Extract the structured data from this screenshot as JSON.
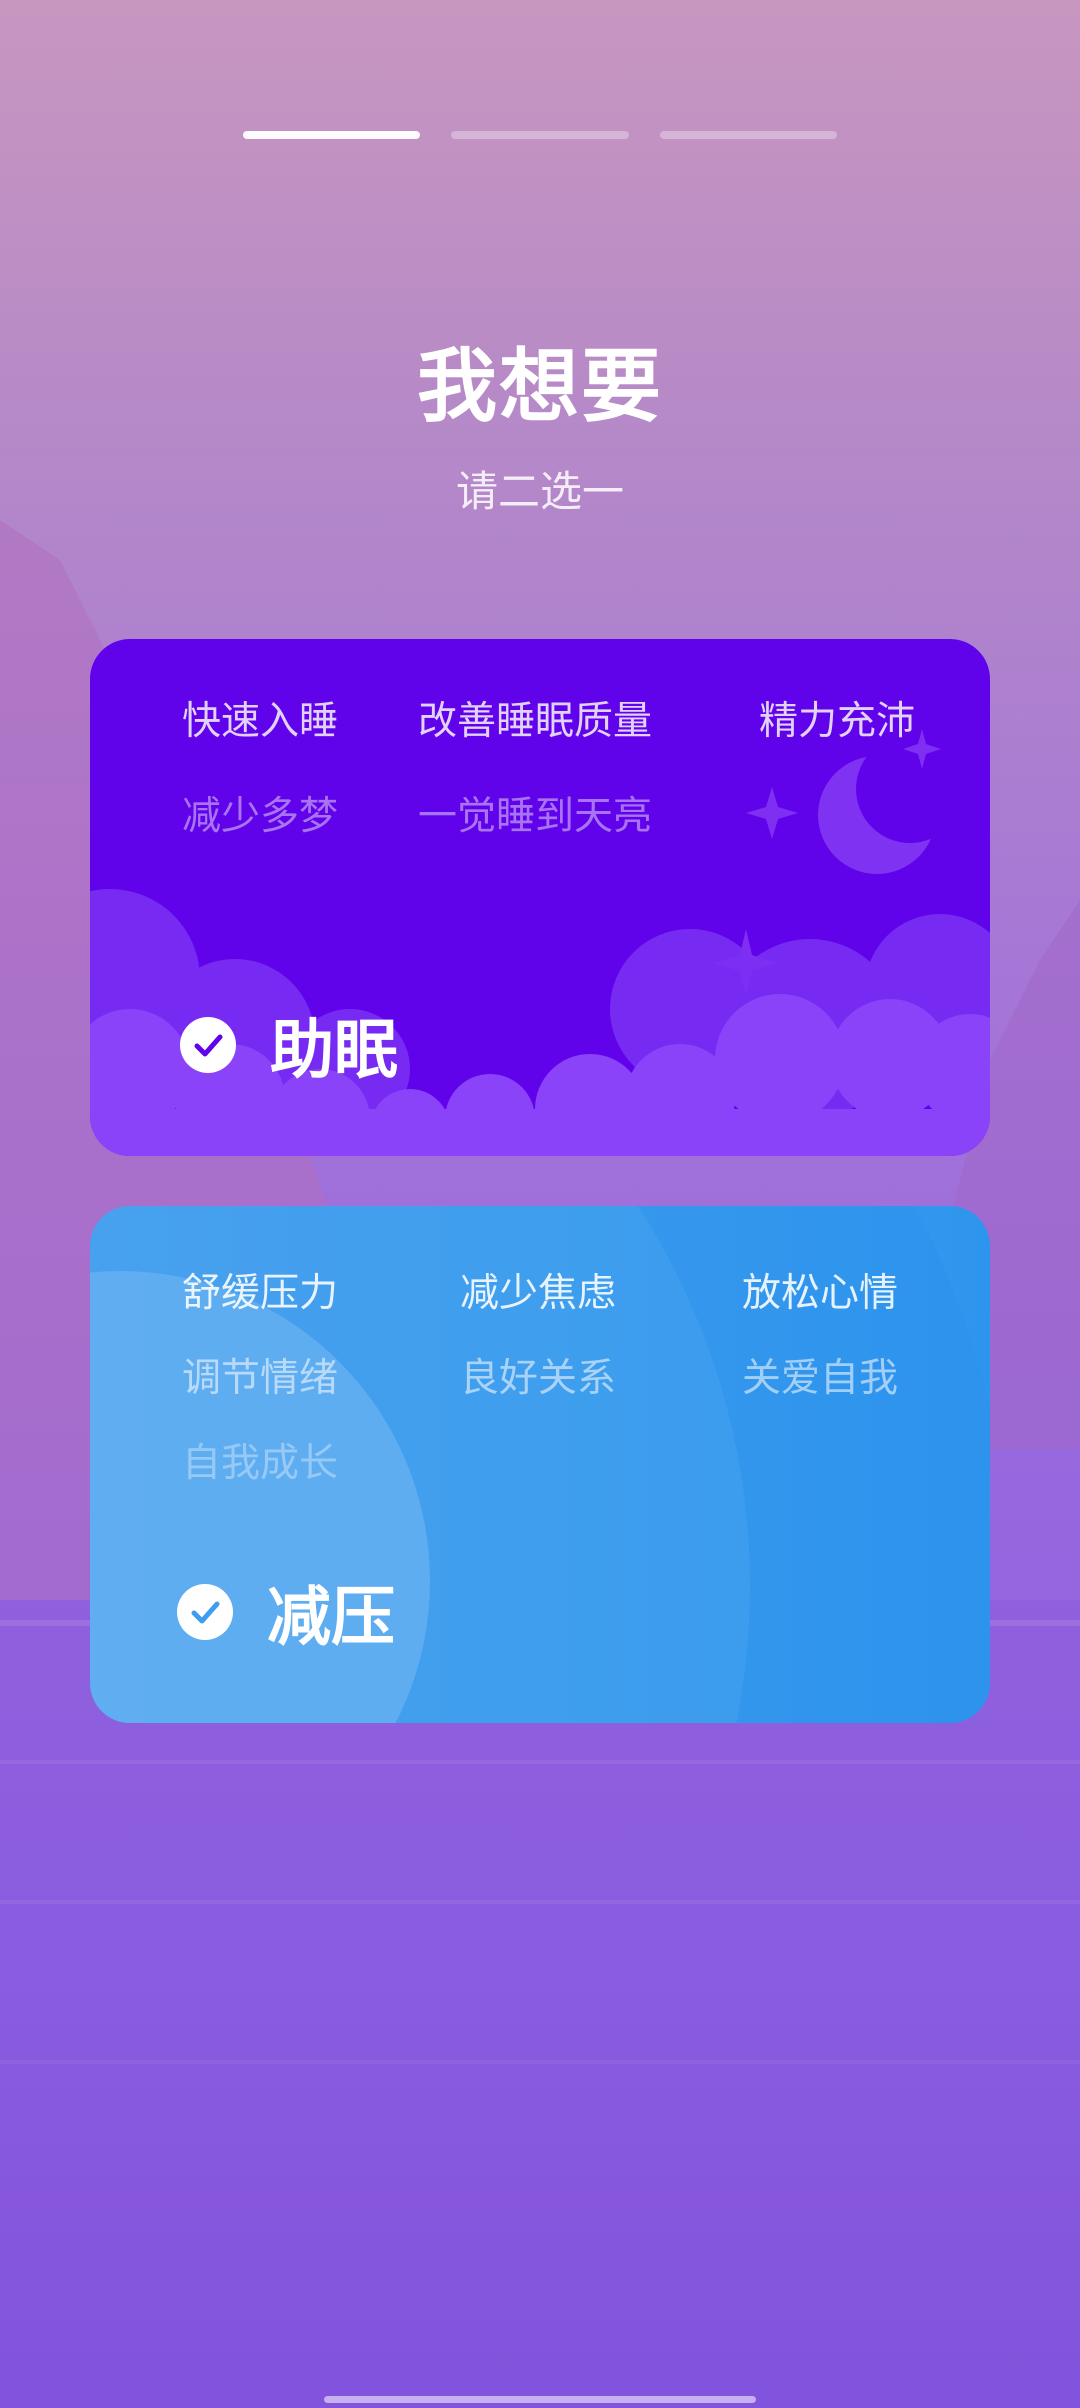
{
  "progress": {
    "total_steps": 3,
    "current_step": 1
  },
  "header": {
    "title": "我想要",
    "subtitle": "请二选一"
  },
  "options": [
    {
      "id": "sleep",
      "label": "助眠",
      "selected": true,
      "color": "#6103ea",
      "tags": [
        "快速入睡",
        "改善睡眠质量",
        "精力充沛",
        "减少多梦",
        "一觉睡到天亮"
      ]
    },
    {
      "id": "stress",
      "label": "减压",
      "selected": true,
      "color": "#3d9eef",
      "tags": [
        "舒缓压力",
        "减少焦虑",
        "放松心情",
        "调节情绪",
        "良好关系",
        "关爱自我",
        "自我成长"
      ]
    }
  ],
  "icons": {
    "check": "check-circle-icon",
    "moon": "moon-icon",
    "star": "sparkle-icon",
    "clouds": "clouds-illustration"
  }
}
